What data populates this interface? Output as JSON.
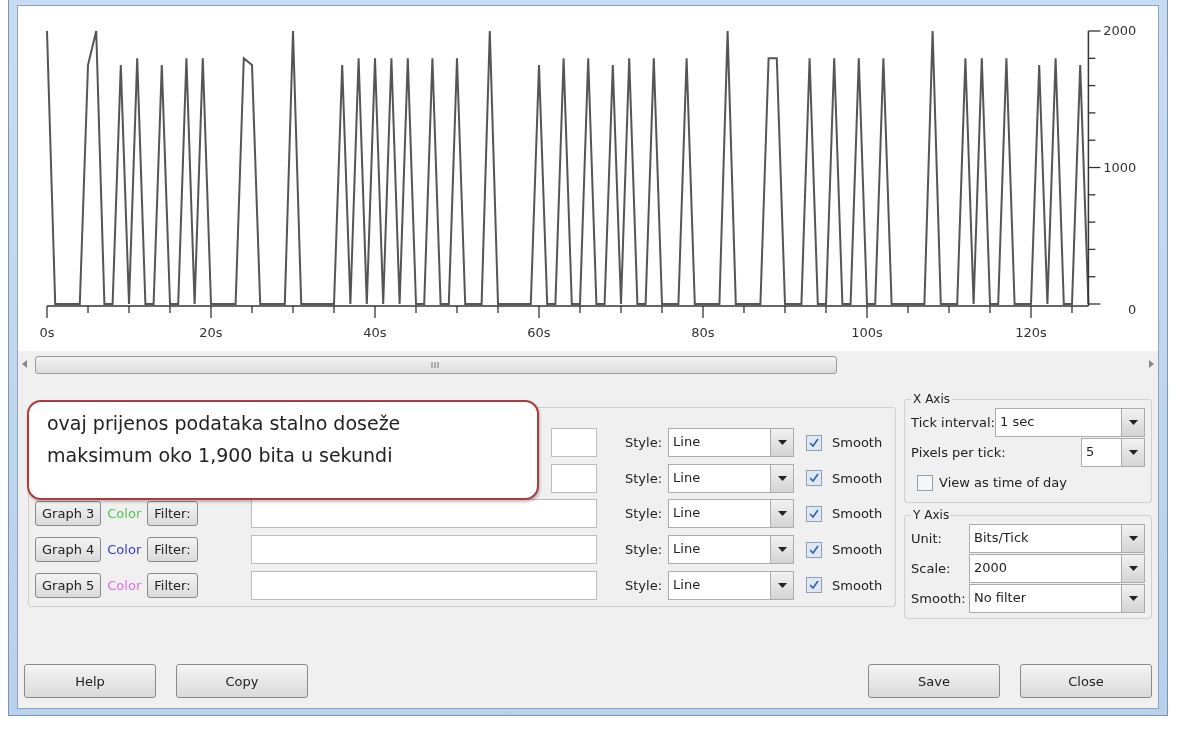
{
  "chart": {
    "chart_data": {
      "type": "line",
      "x": [
        0,
        1,
        2,
        3,
        4,
        5,
        6,
        7,
        8,
        9,
        10,
        11,
        12,
        13,
        14,
        15,
        16,
        17,
        18,
        19,
        20,
        21,
        22,
        23,
        24,
        25,
        26,
        27,
        28,
        29,
        30,
        31,
        32,
        33,
        34,
        35,
        36,
        37,
        38,
        39,
        40,
        41,
        42,
        43,
        44,
        45,
        46,
        47,
        48,
        49,
        50,
        51,
        52,
        53,
        54,
        55,
        56,
        57,
        58,
        59,
        60,
        61,
        62,
        63,
        64,
        65,
        66,
        67,
        68,
        69,
        70,
        71,
        72,
        73,
        74,
        75,
        76,
        77,
        78,
        79,
        80,
        81,
        82,
        83,
        84,
        85,
        86,
        87,
        88,
        89,
        90,
        91,
        92,
        93,
        94,
        95,
        96,
        97,
        98,
        99,
        100,
        101,
        102,
        103,
        104,
        105,
        106,
        107,
        108,
        109,
        110,
        111,
        112,
        113,
        114,
        115,
        116,
        117,
        118,
        119,
        120,
        121,
        122,
        123,
        124,
        125,
        126,
        127
      ],
      "series": [
        {
          "color": "#555555",
          "values": [
            2000,
            0,
            0,
            0,
            0,
            1750,
            2000,
            0,
            0,
            1750,
            0,
            1800,
            0,
            0,
            1750,
            0,
            0,
            1800,
            0,
            1800,
            0,
            0,
            0,
            0,
            1800,
            1750,
            0,
            0,
            0,
            0,
            2000,
            0,
            0,
            0,
            0,
            0,
            1750,
            0,
            1800,
            0,
            1800,
            0,
            1800,
            0,
            1800,
            0,
            0,
            1800,
            0,
            0,
            1800,
            0,
            0,
            0,
            2000,
            0,
            0,
            0,
            0,
            0,
            1750,
            0,
            0,
            1800,
            0,
            0,
            1800,
            0,
            0,
            1750,
            0,
            1800,
            0,
            0,
            1800,
            0,
            0,
            0,
            1800,
            0,
            0,
            0,
            0,
            2000,
            0,
            0,
            0,
            0,
            1800,
            1800,
            0,
            0,
            0,
            1800,
            0,
            0,
            1800,
            0,
            0,
            1800,
            0,
            0,
            1800,
            0,
            0,
            0,
            0,
            0,
            2000,
            0,
            0,
            0,
            1800,
            0,
            1800,
            0,
            0,
            1800,
            0,
            0,
            0,
            1750,
            0,
            1800,
            0,
            0,
            1750,
            0
          ]
        }
      ],
      "xlim": [
        0,
        127
      ],
      "ylim": [
        0,
        2000
      ],
      "xticks": [
        {
          "value": 0,
          "label": "0s"
        },
        {
          "value": 20,
          "label": "20s"
        },
        {
          "value": 40,
          "label": "40s"
        },
        {
          "value": 60,
          "label": "60s"
        },
        {
          "value": 80,
          "label": "80s"
        },
        {
          "value": 100,
          "label": "100s"
        },
        {
          "value": 120,
          "label": "120s"
        }
      ],
      "yticks": [
        0,
        1000,
        2000
      ]
    }
  },
  "callout": {
    "lines": [
      "ovaj prijenos podataka stalno doseže",
      "maksimum oko 1,900  bita u sekundi"
    ]
  },
  "graphs": [
    {
      "style_label": "Style:",
      "style": "Line",
      "smooth_label": "Smooth",
      "smooth": true
    },
    {
      "style_label": "Style:",
      "style": "Line",
      "smooth_label": "Smooth",
      "smooth": true
    },
    {
      "button": "Graph 3",
      "color_label": "Color",
      "color": "#55c455",
      "filter_button": "Filter:",
      "style_label": "Style:",
      "style": "Line",
      "smooth_label": "Smooth",
      "smooth": true
    },
    {
      "button": "Graph 4",
      "color_label": "Color",
      "color": "#3a3ad0",
      "filter_button": "Filter:",
      "style_label": "Style:",
      "style": "Line",
      "smooth_label": "Smooth",
      "smooth": true
    },
    {
      "button": "Graph 5",
      "color_label": "Color",
      "color": "#e070e0",
      "filter_button": "Filter:",
      "style_label": "Style:",
      "style": "Line",
      "smooth_label": "Smooth",
      "smooth": true
    }
  ],
  "x_axis": {
    "title": "X Axis",
    "tick_interval_label": "Tick interval:",
    "tick_interval": "1 sec",
    "pixels_label": "Pixels per tick:",
    "pixels": "5",
    "time_of_day_label": "View as time of day",
    "time_of_day": false
  },
  "y_axis": {
    "title": "Y Axis",
    "unit_label": "Unit:",
    "unit": "Bits/Tick",
    "scale_label": "Scale:",
    "scale": "2000",
    "smooth_label": "Smooth:",
    "smooth": "No filter"
  },
  "buttons": {
    "left": [
      "Help",
      "Copy"
    ],
    "right": [
      "Save",
      "Close"
    ]
  }
}
